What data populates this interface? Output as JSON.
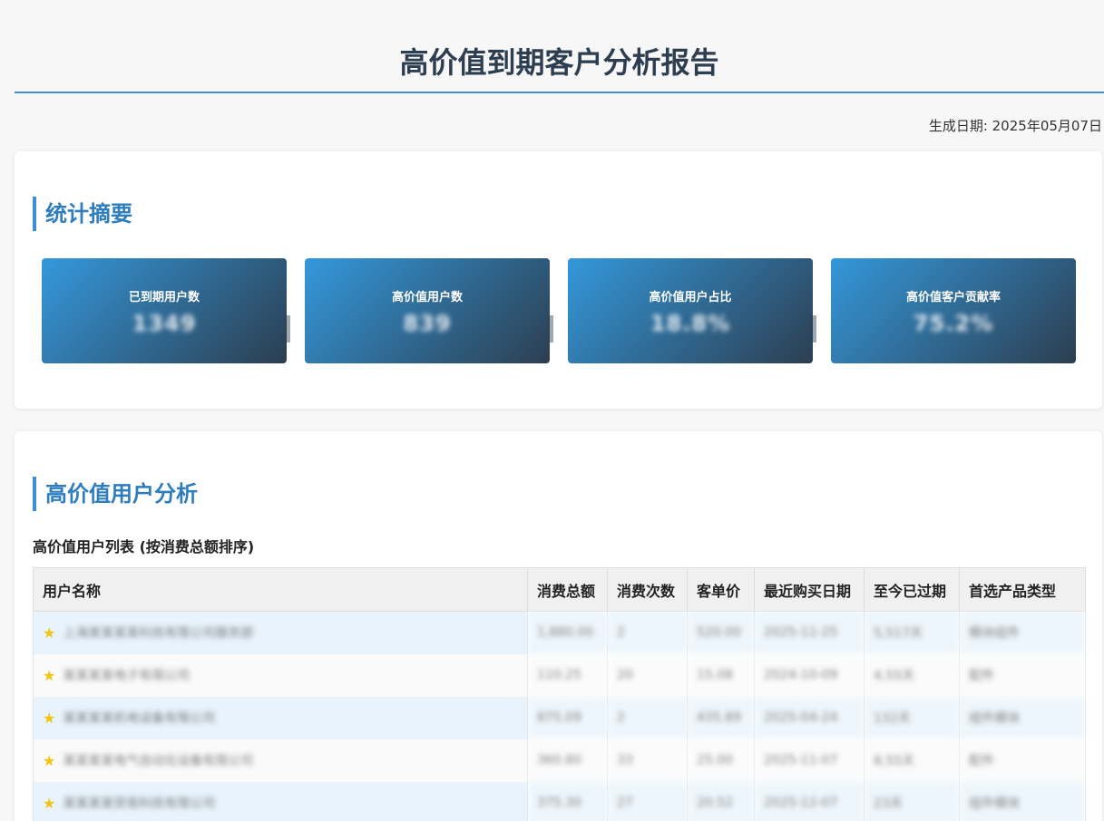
{
  "header": {
    "title": "高价值到期客户分析报告",
    "generated_label": "生成日期: ",
    "generated_date": "2025年05月07日"
  },
  "summary": {
    "heading": "统计摘要",
    "stats": [
      {
        "label": "已到期用户数",
        "value": "1349"
      },
      {
        "label": "高价值用户数",
        "value": "839"
      },
      {
        "label": "高价值用户占比",
        "value": "18.8%"
      },
      {
        "label": "高价值客户贡献率",
        "value": "75.2%"
      }
    ]
  },
  "analysis": {
    "heading": "高价值用户分析",
    "table_title": "高价值用户列表 (按消费总额排序)",
    "columns": [
      "用户名称",
      "消费总额",
      "消费次数",
      "客单价",
      "最近购买日期",
      "至今已过期",
      "首选产品类型"
    ],
    "rows": [
      [
        "上海某某某某科技有限公司服务部",
        "1,880.00",
        "2",
        "520.00",
        "2025-11-25",
        "5,517天",
        "模块组件"
      ],
      [
        "某某某某电子有限公司",
        "110.25",
        "20",
        "15.08",
        "2024-10-09",
        "4,55天",
        "配件"
      ],
      [
        "某某某某机电设备有限公司",
        "875.09",
        "2",
        "435.89",
        "2025-04-24",
        "132天",
        "组件模块"
      ],
      [
        "某某某某电气自动化设备有限公司",
        "360.80",
        "33",
        "25.00",
        "2025-11-07",
        "8,55天",
        "配件"
      ],
      [
        "某某某某贸易科技有限公司",
        "375.30",
        "27",
        "20.52",
        "2025-12-07",
        "23天",
        "组件模块"
      ]
    ]
  },
  "icons": {
    "row_marker": "star-icon",
    "star_color": "#f1c40f"
  },
  "colors": {
    "accent": "#3a8fd6",
    "heading": "#2e7dbf",
    "gradient_start": "#3498db",
    "gradient_end": "#2c3e50",
    "row_highlight": "#e8f3fb"
  }
}
